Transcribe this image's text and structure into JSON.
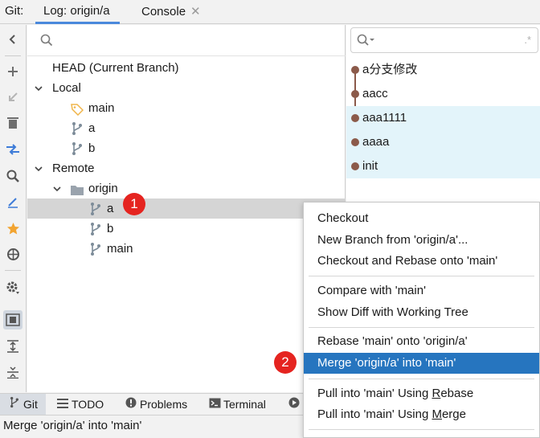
{
  "tabbar": {
    "prefix": "Git:",
    "tabs": [
      {
        "label": "Log: origin/a",
        "active": true
      },
      {
        "label": "Console",
        "active": false
      }
    ],
    "close_glyph": "✕"
  },
  "tree": {
    "head_label": "HEAD (Current Branch)",
    "local_label": "Local",
    "local_branches": [
      "main",
      "a",
      "b"
    ],
    "remote_label": "Remote",
    "remote_name": "origin",
    "remote_branches": [
      "a",
      "b",
      "main"
    ],
    "selected_branch": "a"
  },
  "log": {
    "commits": [
      "a分支修改",
      "aacc",
      "aaa1111",
      "aaaa",
      "init"
    ],
    "graph_color": "#8b5a4a",
    "highlight_color": "#e3f4fa"
  },
  "context_menu": {
    "group1": [
      "Checkout",
      "New Branch from 'origin/a'...",
      "Checkout and Rebase onto 'main'"
    ],
    "group2": [
      "Compare with 'main'",
      "Show Diff with Working Tree"
    ],
    "group3": [
      "Rebase 'main' onto 'origin/a'",
      "Merge 'origin/a' into 'main'"
    ],
    "group4": {
      "pull_rebase_prefix": "Pull into 'main' Using ",
      "pull_rebase_key": "R",
      "pull_rebase_suffix": "ebase",
      "pull_merge_prefix": "Pull into 'main' Using ",
      "pull_merge_key": "M",
      "pull_merge_suffix": "erge"
    },
    "selected_item": "Merge 'origin/a' into 'main'",
    "selected_color": "#2675bf"
  },
  "bottombar": {
    "tabs": [
      {
        "label": "Git",
        "icon": "branch-icon",
        "active": true
      },
      {
        "label": "TODO",
        "icon": "list-icon"
      },
      {
        "label": "Problems",
        "icon": "warning-icon"
      },
      {
        "label": "Terminal",
        "icon": "terminal-icon"
      }
    ]
  },
  "statusbar": {
    "text": "Merge 'origin/a' into 'main'"
  },
  "annotations": {
    "step1": "1",
    "step2": "2",
    "color": "#e52420"
  },
  "icons": {
    "toolbar": [
      "collapse-left-icon",
      "add-icon",
      "update-icon",
      "delete-icon",
      "compare-icon",
      "search-icon",
      "edit-icon",
      "favorite-icon",
      "target-icon",
      "settings-icon",
      "group-by-icon",
      "expand-all-icon",
      "collapse-all-icon"
    ]
  }
}
